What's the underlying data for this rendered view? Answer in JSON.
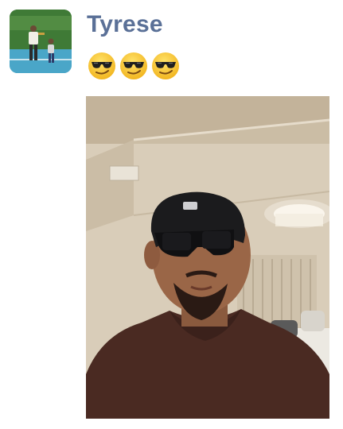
{
  "message": {
    "sender_name": "Tyrese",
    "emojis": [
      "cool-face-emoji",
      "cool-face-emoji",
      "cool-face-emoji"
    ],
    "emoji_glyph": "😎"
  },
  "avatar": {
    "icon": "profile-photo"
  },
  "media": {
    "type": "video-selfie"
  },
  "colors": {
    "sender_name": "#5a7097",
    "emoji_face": "#f9c62b",
    "hoodie": "#4a2a22"
  }
}
